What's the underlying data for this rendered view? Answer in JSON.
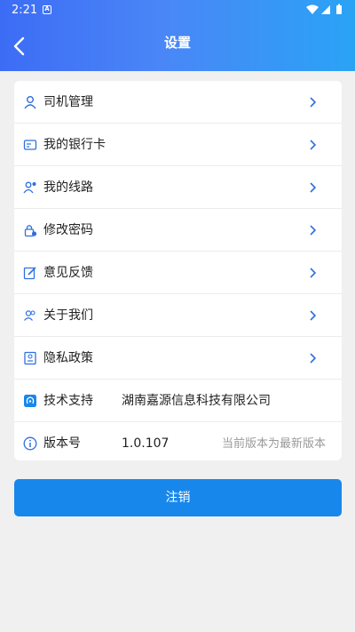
{
  "status_bar": {
    "time": "2:21",
    "notification_glyph": "A"
  },
  "header": {
    "title": "设置",
    "back_icon": "chevron-left-icon"
  },
  "menu": [
    {
      "name": "driver-management",
      "label": "司机管理",
      "icon": "user-icon"
    },
    {
      "name": "my-bank-card",
      "label": "我的银行卡",
      "icon": "card-icon"
    },
    {
      "name": "my-routes",
      "label": "我的线路",
      "icon": "route-user-icon"
    },
    {
      "name": "change-password",
      "label": "修改密码",
      "icon": "lock-icon"
    },
    {
      "name": "feedback",
      "label": "意见反馈",
      "icon": "edit-icon"
    },
    {
      "name": "about-us",
      "label": "关于我们",
      "icon": "people-icon"
    },
    {
      "name": "privacy-policy",
      "label": "隐私政策",
      "icon": "document-icon"
    }
  ],
  "support": {
    "label": "技术支持",
    "value": "湖南嘉源信息科技有限公司",
    "icon": "support-icon"
  },
  "version": {
    "label": "版本号",
    "value": "1.0.107",
    "note": "当前版本为最新版本",
    "icon": "info-icon"
  },
  "logout_label": "注销",
  "colors": {
    "accent": "#1787ec",
    "header_start": "#3c6cf5",
    "header_end": "#2aa3f5",
    "icon": "#2f6fe0"
  }
}
